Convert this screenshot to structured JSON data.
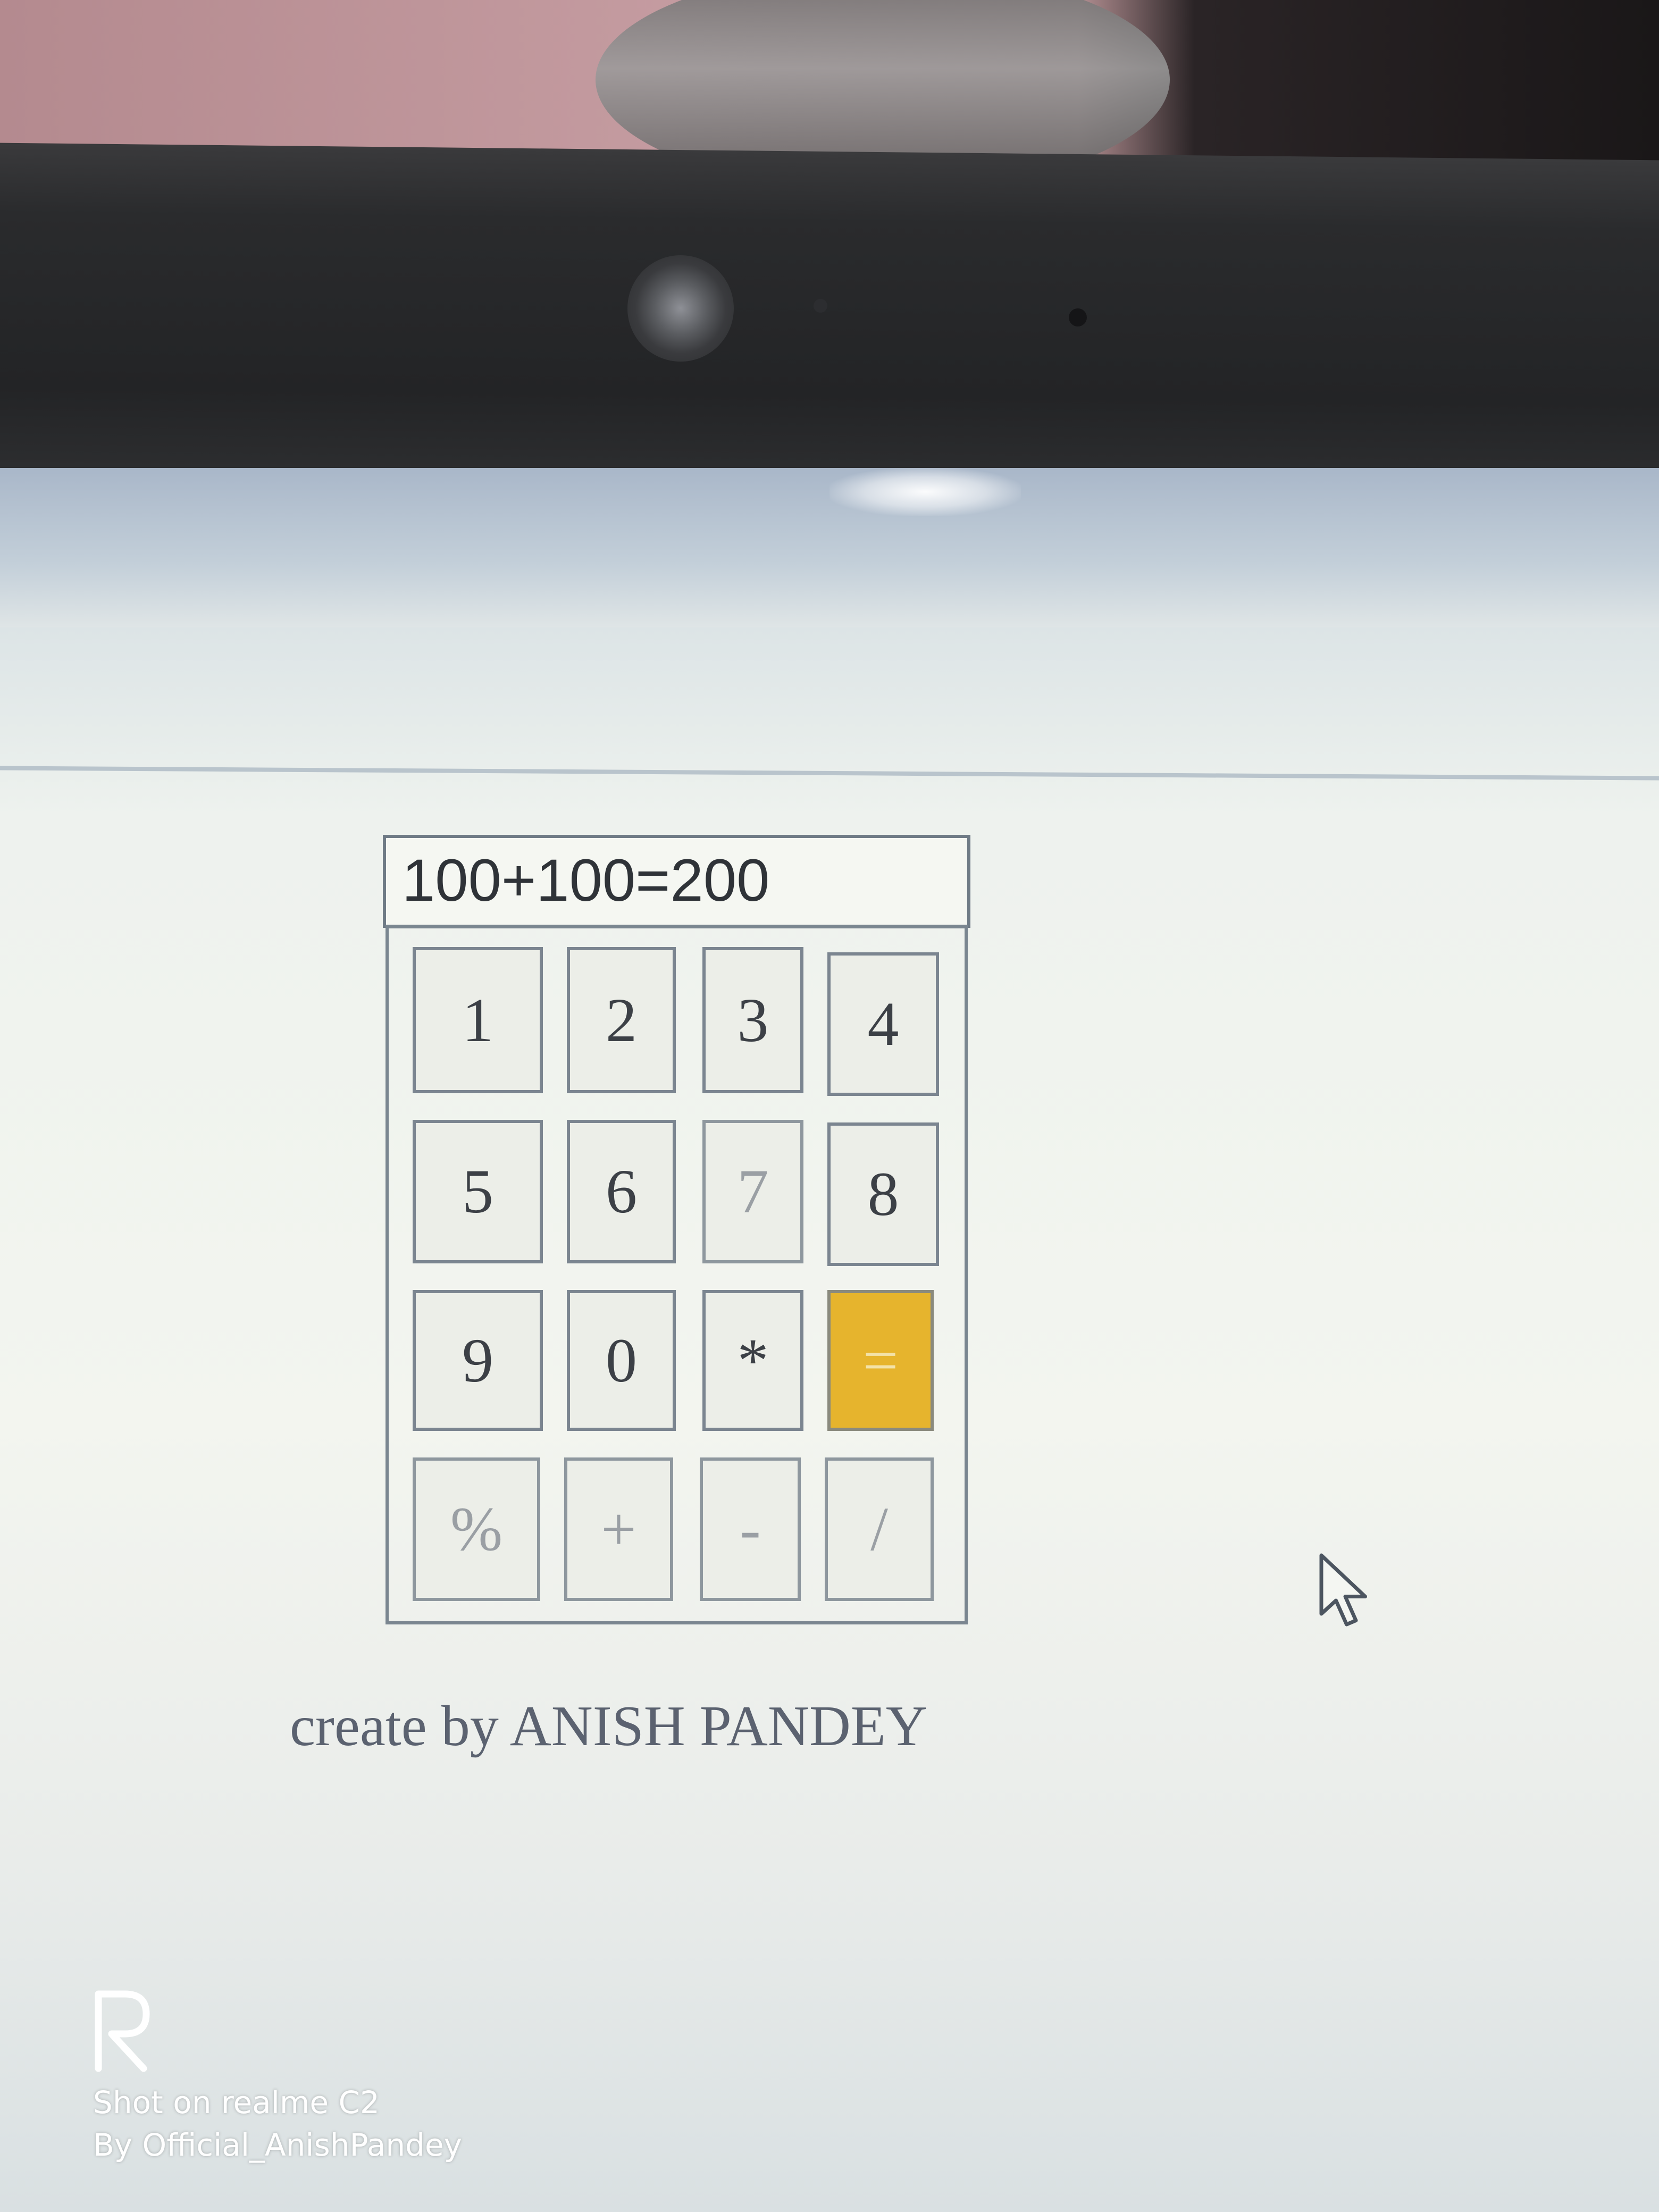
{
  "display": {
    "expression": "100+100=200"
  },
  "keypad": {
    "rows": [
      [
        "1",
        "2",
        "3",
        "4"
      ],
      [
        "5",
        "6",
        "7",
        "8"
      ],
      [
        "9",
        "0",
        "*",
        "="
      ],
      [
        "%",
        "+",
        "-",
        "/"
      ]
    ],
    "equals_color": "#e6b42d"
  },
  "credit": {
    "text": "create by ANISH PANDEY"
  },
  "watermark": {
    "logo": "R",
    "line1": "Shot on realme C2",
    "line2": "By Official_AnishPandey"
  },
  "icons": [
    "webcam-icon",
    "mouse-pointer-icon",
    "realme-logo-icon"
  ]
}
